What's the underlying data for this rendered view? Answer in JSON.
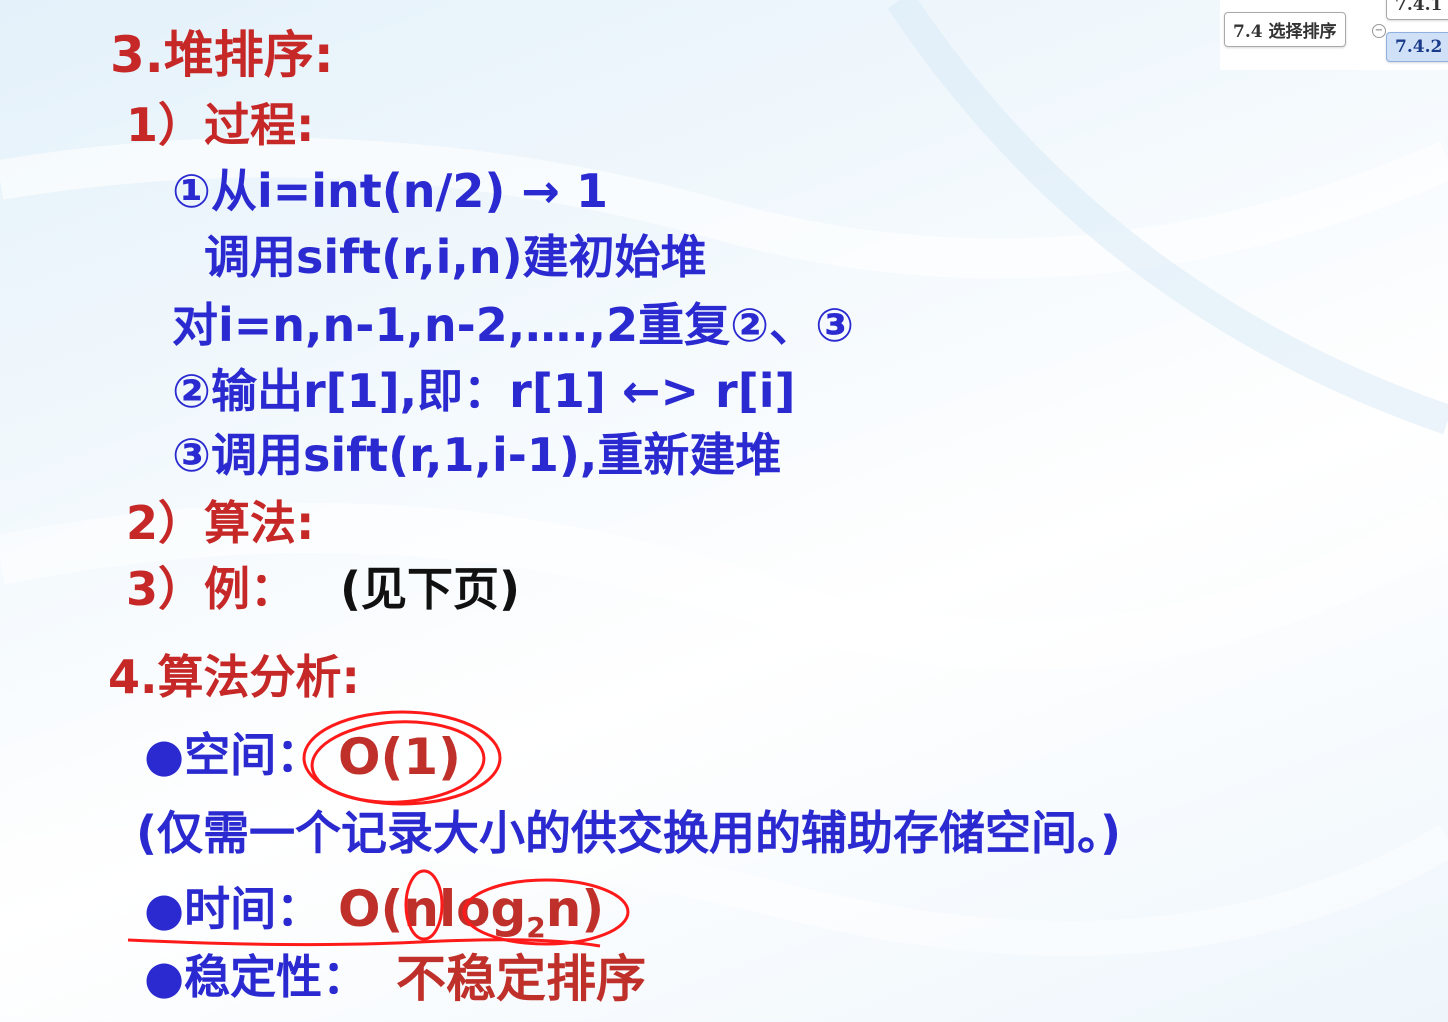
{
  "slide": {
    "heading3": "3.堆排序:",
    "item1_title": "1）过程:",
    "step1a": "①从i=int(n/2) → 1",
    "step1b": "调用sift(r,i,n)建初始堆",
    "loop": "对i=n,n-1,n-2,….,2重复②、③",
    "step2": "②输出r[1],即：r[1] ←> r[i]",
    "step3": "③调用sift(r,1,i-1),重新建堆",
    "item2_title": "2）算法:",
    "item3_title": "3）例：",
    "item3_note": "(见下页)",
    "heading4": "4.算法分析:",
    "space_label": "●空间：",
    "space_value": "O(1)",
    "space_note": "(仅需一个记录大小的供交换用的辅助存储空间。)",
    "time_label": "●时间：",
    "time_value_prefix": "O(nlog",
    "time_value_sub": "2",
    "time_value_suffix": "n)",
    "stability_label": "●稳定性：",
    "stability_value": "不稳定排序"
  },
  "minimap": {
    "node_main": "7.4 选择排序",
    "node_child1": "7.4.1",
    "node_child2": "7.4.2"
  },
  "colors": {
    "heading": "#c62828",
    "body": "#2a2ad0",
    "value": "#c0302a",
    "annotation": "#ff1a1a"
  }
}
